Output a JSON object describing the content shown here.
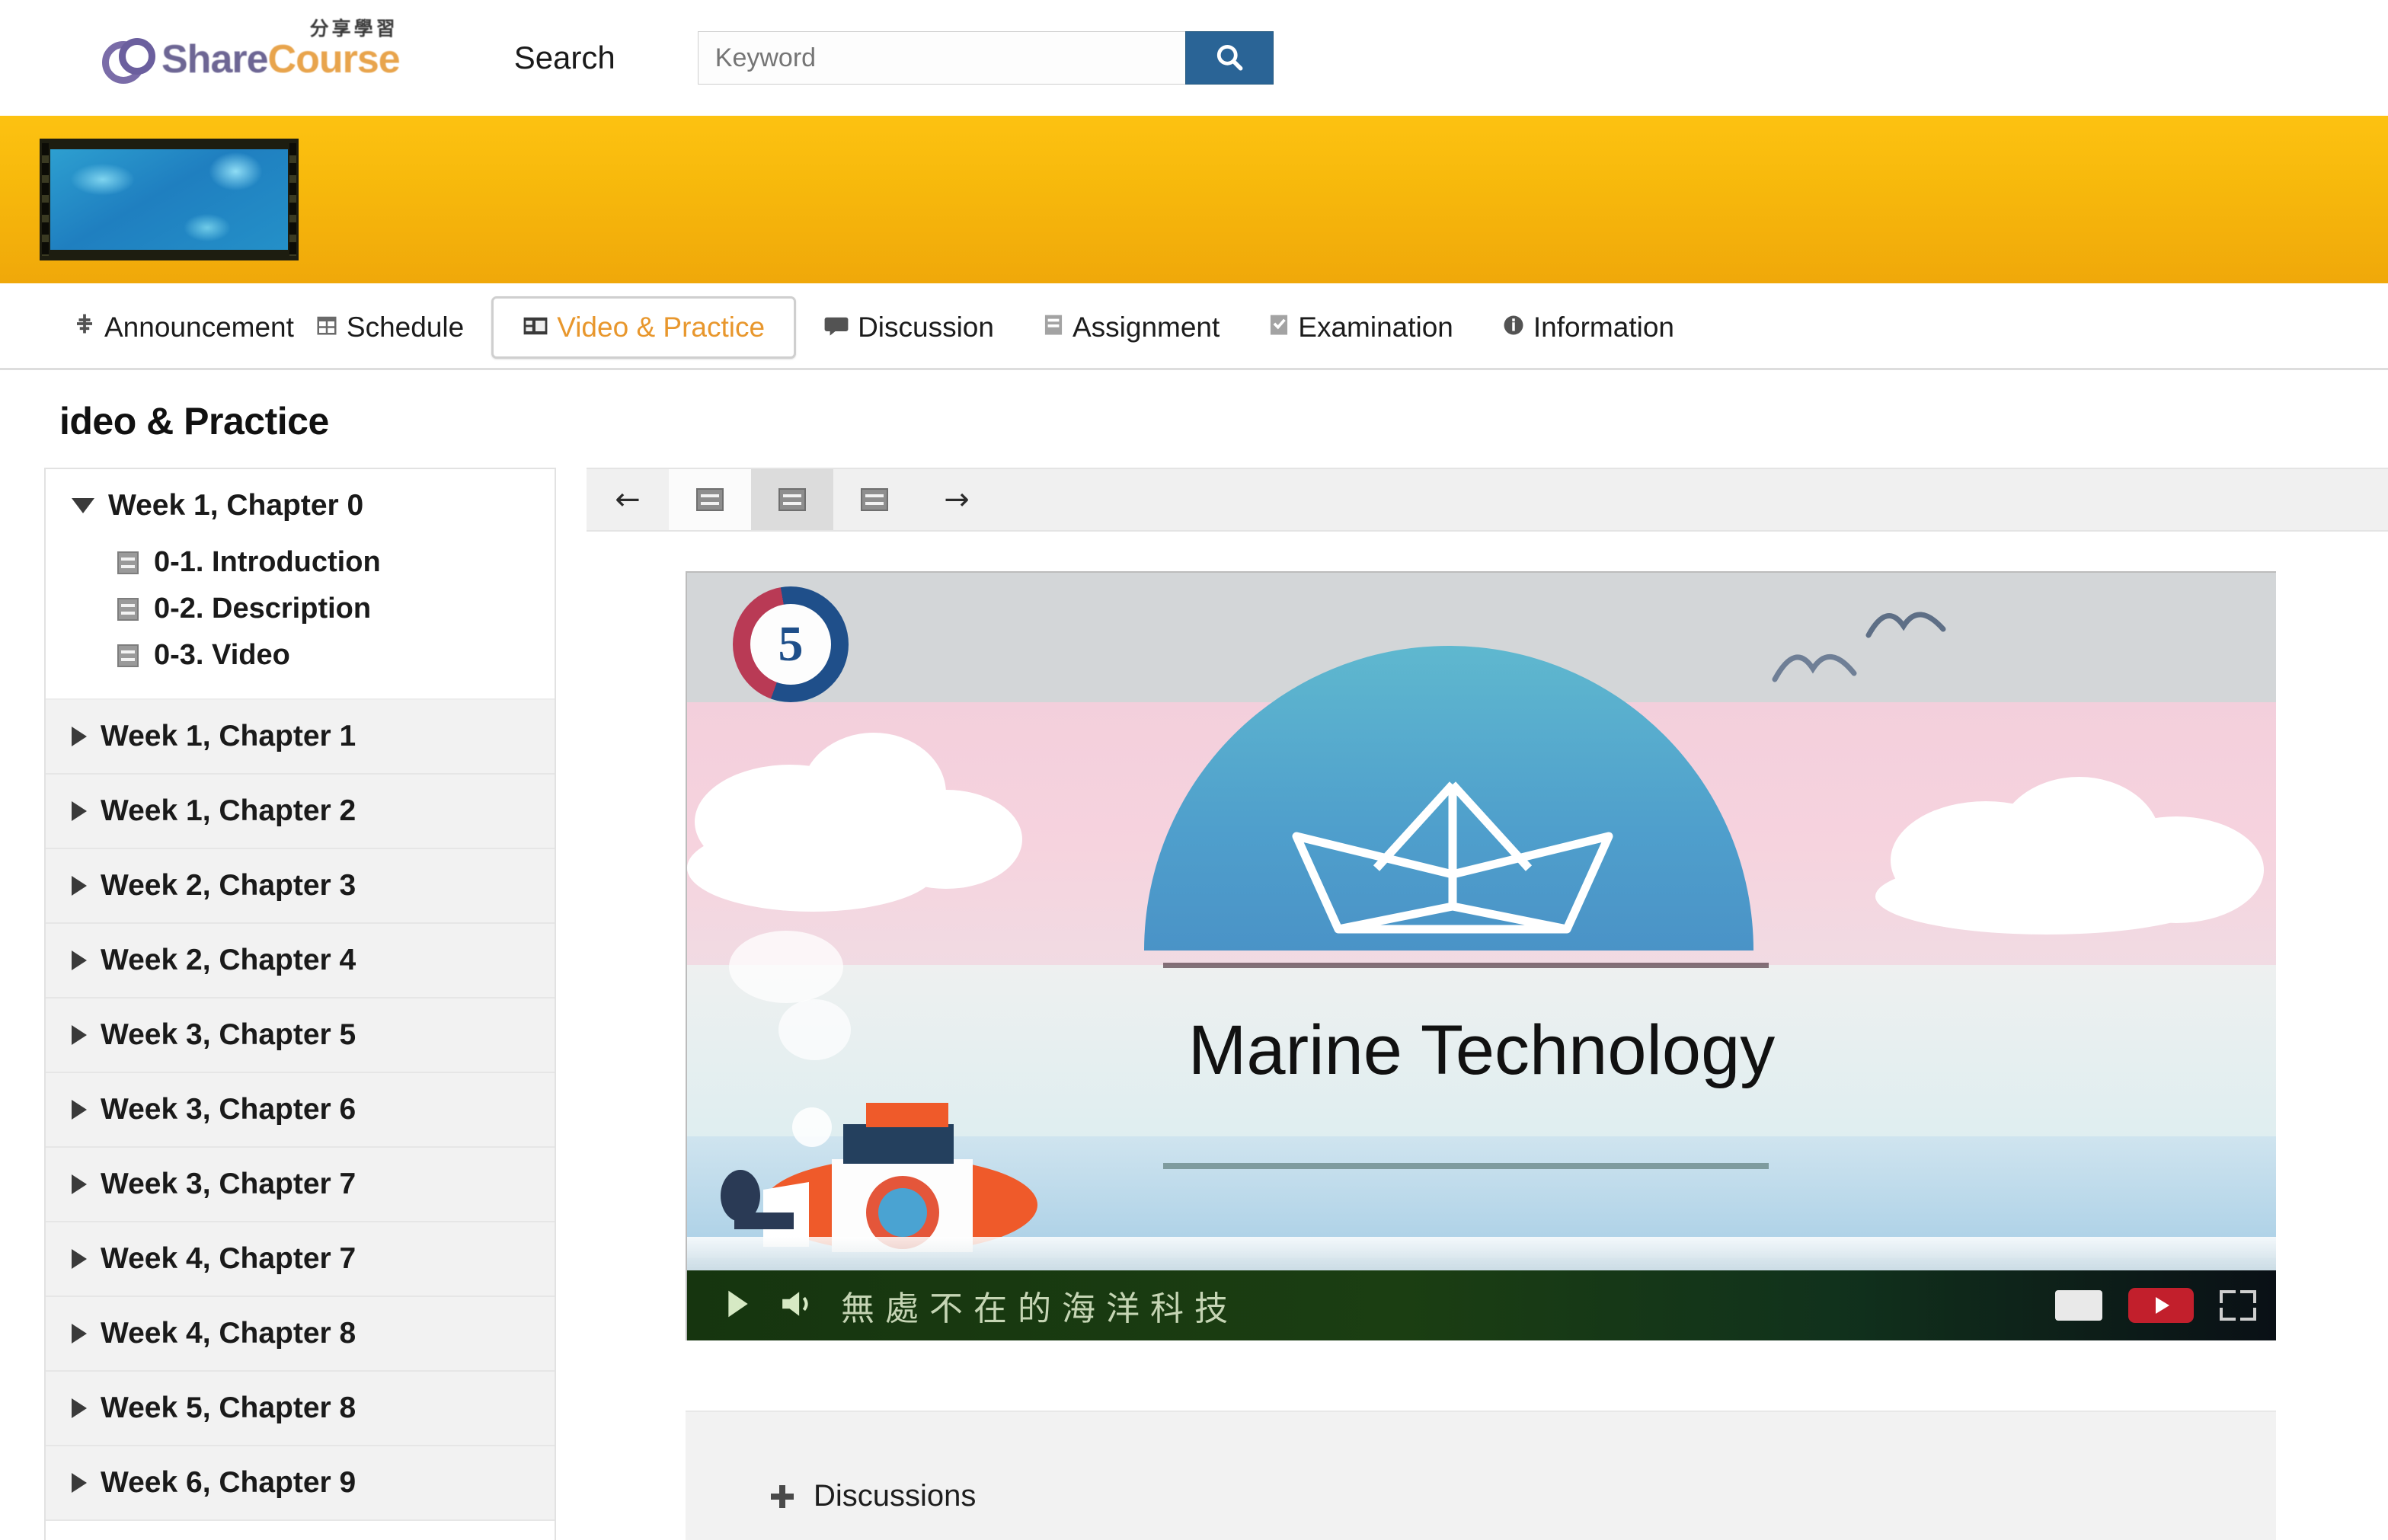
{
  "header": {
    "logo": {
      "share": "Share",
      "course": "Course",
      "cn": "分享學習"
    },
    "search_label": "Search",
    "search_placeholder": "Keyword",
    "search_value": "",
    "search_icon": "search-icon"
  },
  "banner": {
    "thumbnail_alt": "ocean-course-thumbnail"
  },
  "nav": {
    "tabs": [
      {
        "label": "Announcement",
        "icon": "megaphone-icon",
        "active": false
      },
      {
        "label": "Schedule",
        "icon": "calendar-icon",
        "active": false
      },
      {
        "label": "Video & Practice",
        "icon": "film-icon",
        "active": true
      },
      {
        "label": "Discussion",
        "icon": "comment-icon",
        "active": false
      },
      {
        "label": "Assignment",
        "icon": "clipboard-icon",
        "active": false
      },
      {
        "label": "Examination",
        "icon": "exam-icon",
        "active": false
      },
      {
        "label": "Information",
        "icon": "info-icon",
        "active": false
      }
    ]
  },
  "page": {
    "title": "ideo & Practice"
  },
  "sidebar": {
    "chapters": [
      {
        "label": "Week 1, Chapter 0",
        "expanded": true,
        "items": [
          {
            "label": "0-1. Introduction"
          },
          {
            "label": "0-2. Description"
          },
          {
            "label": "0-3. Video"
          }
        ]
      },
      {
        "label": "Week 1, Chapter 1",
        "expanded": false,
        "items": []
      },
      {
        "label": "Week 1, Chapter 2",
        "expanded": false,
        "items": []
      },
      {
        "label": "Week 2, Chapter 3",
        "expanded": false,
        "items": []
      },
      {
        "label": "Week 2, Chapter 4",
        "expanded": false,
        "items": []
      },
      {
        "label": "Week 3, Chapter 5",
        "expanded": false,
        "items": []
      },
      {
        "label": "Week 3, Chapter 6",
        "expanded": false,
        "items": []
      },
      {
        "label": "Week 3, Chapter 7",
        "expanded": false,
        "items": []
      },
      {
        "label": "Week 4, Chapter 7",
        "expanded": false,
        "items": []
      },
      {
        "label": "Week 4, Chapter 8",
        "expanded": false,
        "items": []
      },
      {
        "label": "Week 5, Chapter 8",
        "expanded": false,
        "items": []
      },
      {
        "label": "Week 6, Chapter 9",
        "expanded": false,
        "items": []
      }
    ]
  },
  "toolbar": {
    "prev_icon": "arrow-left-icon",
    "next_icon": "arrow-right-icon",
    "slides": [
      {
        "icon": "slide-icon",
        "current": false
      },
      {
        "icon": "slide-icon",
        "current": true
      },
      {
        "icon": "slide-icon",
        "current": false
      }
    ]
  },
  "slide": {
    "title": "Marine Technology",
    "emblem_text": "5",
    "emblem_name": "university-emblem"
  },
  "player": {
    "play_icon": "play-icon",
    "volume_icon": "volume-icon",
    "caption_text": "無處不在的海洋科技",
    "cc_icon": "captions-icon",
    "youtube_icon": "youtube-logo-icon",
    "fullscreen_icon": "fullscreen-icon"
  },
  "discussions": {
    "label": "Discussions",
    "add_icon": "plus-icon"
  },
  "colors": {
    "accent_orange": "#e8972d",
    "banner_yellow": "#f7b90c",
    "search_blue": "#2a6496",
    "logo_purple": "#6d6694"
  }
}
